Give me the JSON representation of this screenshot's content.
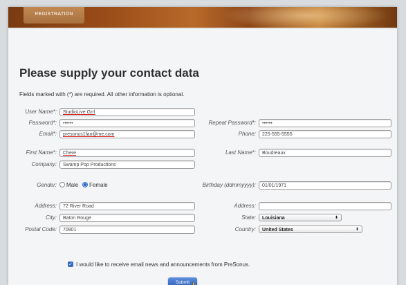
{
  "tab_label": "REGISTRATION",
  "heading": "Please supply your contact data",
  "required_note": "Fields marked with (*) are required. All other information is optional.",
  "fields": {
    "user_name": {
      "label": "User Name*:",
      "value": "StudioLive Grrl"
    },
    "password": {
      "label": "Password*:",
      "value": "••••••"
    },
    "repeat_password": {
      "label": "Repeat Password*:",
      "value": "••••••"
    },
    "email": {
      "label": "Email*:",
      "value": "presonus1fan@me.com"
    },
    "phone": {
      "label": "Phone:",
      "value": "225-555-5555"
    },
    "first_name": {
      "label": "First Name*:",
      "value": "Chere"
    },
    "last_name": {
      "label": "Last Name*:",
      "value": "Boudreaux"
    },
    "company": {
      "label": "Company:",
      "value": "Swamp Pop Productions"
    },
    "birthday": {
      "label": "Birthday (ddmmyyyy):",
      "value": "01/01/1971"
    },
    "address": {
      "label": "Address:",
      "value": "72 River Road"
    },
    "address2": {
      "label": "Address:",
      "value": ""
    },
    "city": {
      "label": "City:",
      "value": "Baton Rouge"
    },
    "state": {
      "label": "State:",
      "value": "Louisiana"
    },
    "postal_code": {
      "label": "Postal Code:",
      "value": "70801"
    },
    "country": {
      "label": "Country:",
      "value": "United States"
    }
  },
  "gender": {
    "label": "Gender:",
    "options": [
      "Male",
      "Female"
    ],
    "selected": "Female"
  },
  "consent_text": "I would like to receive email news and announcements from PreSonus.",
  "consent_checked": true,
  "submit_label": "Submit",
  "colors": {
    "accent": "#2e68c9",
    "banner": "#9a4c18"
  }
}
